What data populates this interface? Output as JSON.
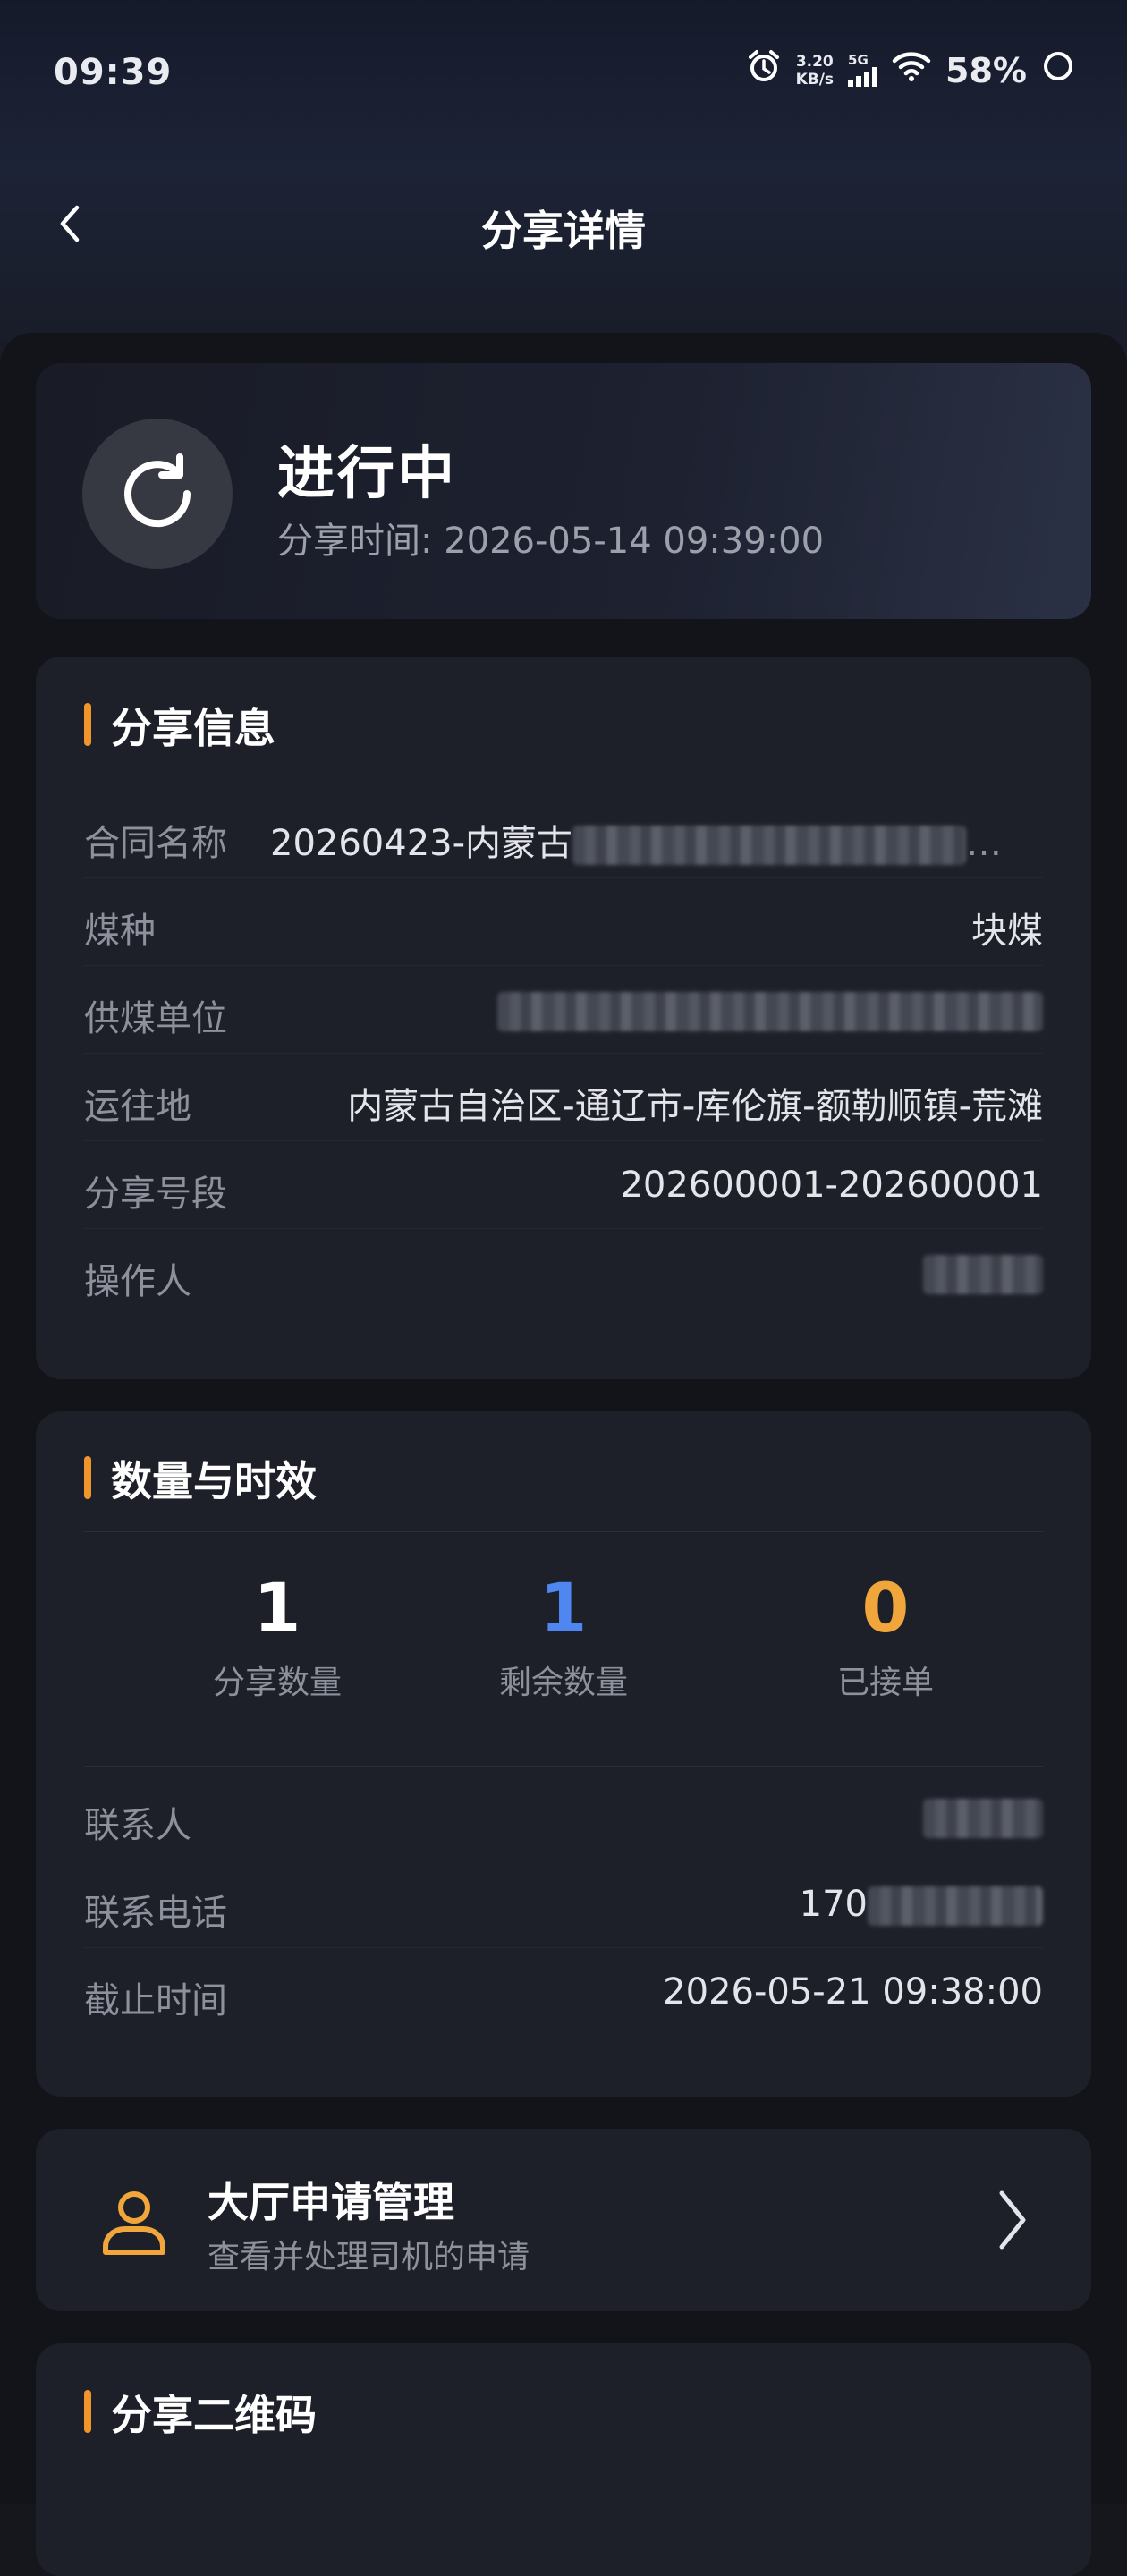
{
  "status_bar": {
    "time": "09:39",
    "speed_value": "3.20",
    "speed_unit": "KB/s",
    "network": "5G",
    "battery": "58%"
  },
  "nav": {
    "title": "分享详情"
  },
  "status_card": {
    "state": "进行中",
    "share_time": "分享时间: 2026-05-14 09:39:00"
  },
  "share_info": {
    "title": "分享信息",
    "rows": [
      {
        "label": "合同名称",
        "value": "20260423-内蒙古",
        "suffix": "…"
      },
      {
        "label": "煤种",
        "value": "块煤"
      },
      {
        "label": "供煤单位",
        "value": ""
      },
      {
        "label": "运往地",
        "value": "内蒙古自治区-通辽市-库伦旗-额勒顺镇-荒滩"
      },
      {
        "label": "分享号段",
        "value": "202600001-202600001"
      },
      {
        "label": "操作人",
        "value": ""
      }
    ]
  },
  "quantity": {
    "title": "数量与时效",
    "stats": [
      {
        "value": "1",
        "label": "分享数量",
        "color": "#ffffff"
      },
      {
        "value": "1",
        "label": "剩余数量",
        "color": "#4f86f0"
      },
      {
        "value": "0",
        "label": "已接单",
        "color": "#f0a63a"
      }
    ],
    "rows": [
      {
        "label": "联系人",
        "value": ""
      },
      {
        "label": "联系电话",
        "value": "170"
      },
      {
        "label": "截止时间",
        "value": "2026-05-21 09:38:00"
      }
    ]
  },
  "hall": {
    "title": "大厅申请管理",
    "subtitle": "查看并处理司机的申请"
  },
  "qr": {
    "title": "分享二维码"
  },
  "colors": {
    "accent": "#f0952a",
    "blue": "#4f86f0",
    "orange": "#f0a63a"
  }
}
